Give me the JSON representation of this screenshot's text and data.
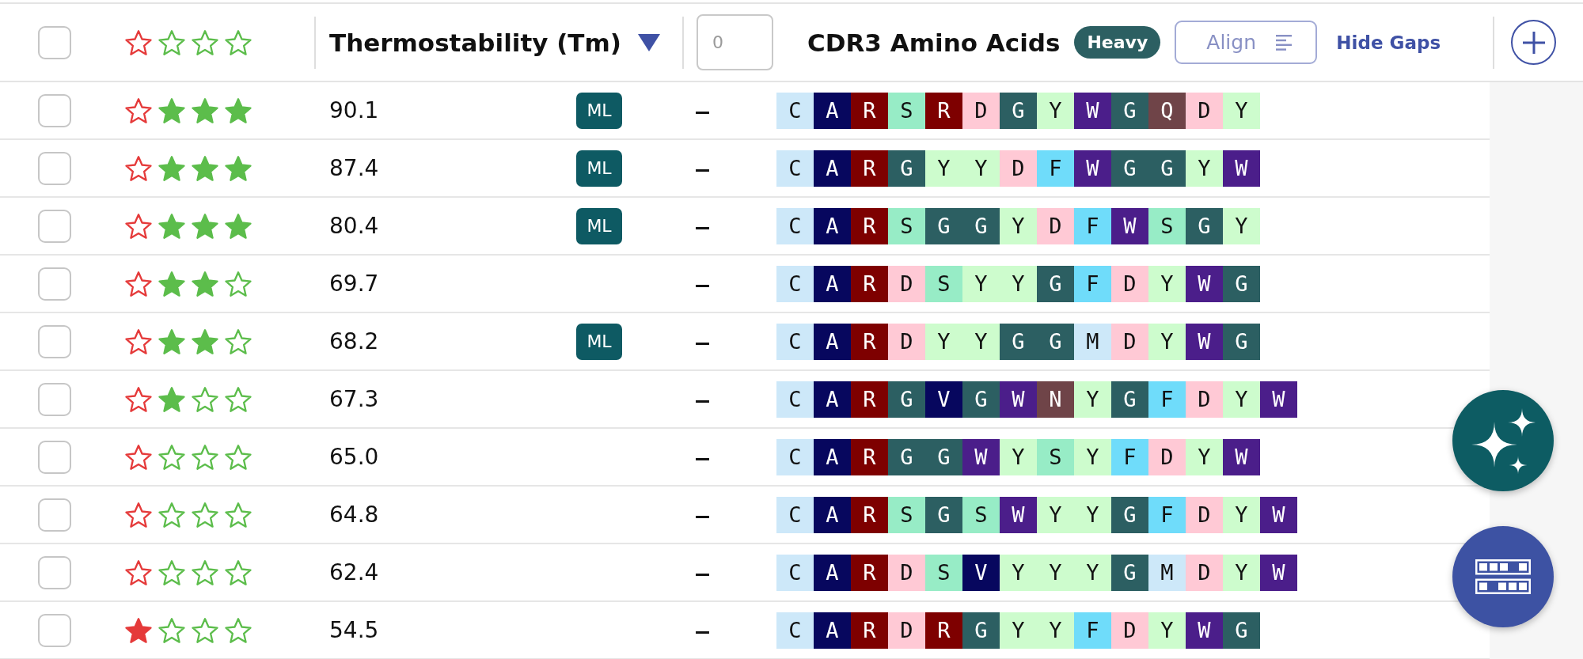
{
  "header": {
    "select_all": {
      "checked": false
    },
    "rating_filter": {
      "rejected": false,
      "stars": 0
    },
    "sort_column": {
      "label": "Thermostability (Tm)",
      "sort_descending": true
    },
    "filter_input": {
      "placeholder": "0"
    },
    "sequence_column": {
      "label": "CDR3 Amino Acids",
      "chain": "Heavy",
      "align_button": "Align",
      "gaps_link": "Hide Gaps"
    }
  },
  "rows": [
    {
      "checked": false,
      "rejected": false,
      "stars": 3,
      "tm": "90.1",
      "badge": "ML",
      "column_4": "–",
      "residues": [
        {
          "letter": "C",
          "color": "#cde8f9"
        },
        {
          "letter": "A",
          "color": "#07075e"
        },
        {
          "letter": "R",
          "color": "#7e0000"
        },
        {
          "letter": "S",
          "color": "#97ecc6"
        },
        {
          "letter": "R",
          "color": "#7e0000"
        },
        {
          "letter": "D",
          "color": "#ffc9d5"
        },
        {
          "letter": "G",
          "color": "#2c5f62"
        },
        {
          "letter": "Y",
          "color": "#cdfccd"
        },
        {
          "letter": "W",
          "color": "#4b1e8a"
        },
        {
          "letter": "G",
          "color": "#2c5f62"
        },
        {
          "letter": "Q",
          "color": "#6f4448"
        },
        {
          "letter": "D",
          "color": "#ffc9d5"
        },
        {
          "letter": "Y",
          "color": "#cdfccd"
        }
      ]
    },
    {
      "checked": false,
      "rejected": false,
      "stars": 3,
      "tm": "87.4",
      "badge": "ML",
      "column_4": "–",
      "residues": [
        {
          "letter": "C",
          "color": "#cde8f9"
        },
        {
          "letter": "A",
          "color": "#07075e"
        },
        {
          "letter": "R",
          "color": "#7e0000"
        },
        {
          "letter": "G",
          "color": "#2c5f62"
        },
        {
          "letter": "Y",
          "color": "#cdfccd"
        },
        {
          "letter": "Y",
          "color": "#cdfccd"
        },
        {
          "letter": "D",
          "color": "#ffc9d5"
        },
        {
          "letter": "F",
          "color": "#6fdcfa"
        },
        {
          "letter": "W",
          "color": "#4b1e8a"
        },
        {
          "letter": "G",
          "color": "#2c5f62"
        },
        {
          "letter": "G",
          "color": "#2c5f62"
        },
        {
          "letter": "Y",
          "color": "#cdfccd"
        },
        {
          "letter": "W",
          "color": "#4b1e8a"
        }
      ]
    },
    {
      "checked": false,
      "rejected": false,
      "stars": 3,
      "tm": "80.4",
      "badge": "ML",
      "column_4": "–",
      "residues": [
        {
          "letter": "C",
          "color": "#cde8f9"
        },
        {
          "letter": "A",
          "color": "#07075e"
        },
        {
          "letter": "R",
          "color": "#7e0000"
        },
        {
          "letter": "S",
          "color": "#97ecc6"
        },
        {
          "letter": "G",
          "color": "#2c5f62"
        },
        {
          "letter": "G",
          "color": "#2c5f62"
        },
        {
          "letter": "Y",
          "color": "#cdfccd"
        },
        {
          "letter": "D",
          "color": "#ffc9d5"
        },
        {
          "letter": "F",
          "color": "#6fdcfa"
        },
        {
          "letter": "W",
          "color": "#4b1e8a"
        },
        {
          "letter": "S",
          "color": "#97ecc6"
        },
        {
          "letter": "G",
          "color": "#2c5f62"
        },
        {
          "letter": "Y",
          "color": "#cdfccd"
        }
      ]
    },
    {
      "checked": false,
      "rejected": false,
      "stars": 2,
      "tm": "69.7",
      "column_4": "–",
      "residues": [
        {
          "letter": "C",
          "color": "#cde8f9"
        },
        {
          "letter": "A",
          "color": "#07075e"
        },
        {
          "letter": "R",
          "color": "#7e0000"
        },
        {
          "letter": "D",
          "color": "#ffc9d5"
        },
        {
          "letter": "S",
          "color": "#97ecc6"
        },
        {
          "letter": "Y",
          "color": "#cdfccd"
        },
        {
          "letter": "Y",
          "color": "#cdfccd"
        },
        {
          "letter": "G",
          "color": "#2c5f62"
        },
        {
          "letter": "F",
          "color": "#6fdcfa"
        },
        {
          "letter": "D",
          "color": "#ffc9d5"
        },
        {
          "letter": "Y",
          "color": "#cdfccd"
        },
        {
          "letter": "W",
          "color": "#4b1e8a"
        },
        {
          "letter": "G",
          "color": "#2c5f62"
        }
      ]
    },
    {
      "checked": false,
      "rejected": false,
      "stars": 2,
      "tm": "68.2",
      "badge": "ML",
      "column_4": "–",
      "residues": [
        {
          "letter": "C",
          "color": "#cde8f9"
        },
        {
          "letter": "A",
          "color": "#07075e"
        },
        {
          "letter": "R",
          "color": "#7e0000"
        },
        {
          "letter": "D",
          "color": "#ffc9d5"
        },
        {
          "letter": "Y",
          "color": "#cdfccd"
        },
        {
          "letter": "Y",
          "color": "#cdfccd"
        },
        {
          "letter": "G",
          "color": "#2c5f62"
        },
        {
          "letter": "G",
          "color": "#2c5f62"
        },
        {
          "letter": "M",
          "color": "#cde8f9"
        },
        {
          "letter": "D",
          "color": "#ffc9d5"
        },
        {
          "letter": "Y",
          "color": "#cdfccd"
        },
        {
          "letter": "W",
          "color": "#4b1e8a"
        },
        {
          "letter": "G",
          "color": "#2c5f62"
        }
      ]
    },
    {
      "checked": false,
      "rejected": false,
      "stars": 1,
      "tm": "67.3",
      "column_4": "–",
      "residues": [
        {
          "letter": "C",
          "color": "#cde8f9"
        },
        {
          "letter": "A",
          "color": "#07075e"
        },
        {
          "letter": "R",
          "color": "#7e0000"
        },
        {
          "letter": "G",
          "color": "#2c5f62"
        },
        {
          "letter": "V",
          "color": "#07075e"
        },
        {
          "letter": "G",
          "color": "#2c5f62"
        },
        {
          "letter": "W",
          "color": "#4b1e8a"
        },
        {
          "letter": "N",
          "color": "#6f4448"
        },
        {
          "letter": "Y",
          "color": "#cdfccd"
        },
        {
          "letter": "G",
          "color": "#2c5f62"
        },
        {
          "letter": "F",
          "color": "#6fdcfa"
        },
        {
          "letter": "D",
          "color": "#ffc9d5"
        },
        {
          "letter": "Y",
          "color": "#cdfccd"
        },
        {
          "letter": "W",
          "color": "#4b1e8a"
        }
      ]
    },
    {
      "checked": false,
      "rejected": false,
      "stars": 0,
      "tm": "65.0",
      "column_4": "–",
      "residues": [
        {
          "letter": "C",
          "color": "#cde8f9"
        },
        {
          "letter": "A",
          "color": "#07075e"
        },
        {
          "letter": "R",
          "color": "#7e0000"
        },
        {
          "letter": "G",
          "color": "#2c5f62"
        },
        {
          "letter": "G",
          "color": "#2c5f62"
        },
        {
          "letter": "W",
          "color": "#4b1e8a"
        },
        {
          "letter": "Y",
          "color": "#cdfccd"
        },
        {
          "letter": "S",
          "color": "#97ecc6"
        },
        {
          "letter": "Y",
          "color": "#cdfccd"
        },
        {
          "letter": "F",
          "color": "#6fdcfa"
        },
        {
          "letter": "D",
          "color": "#ffc9d5"
        },
        {
          "letter": "Y",
          "color": "#cdfccd"
        },
        {
          "letter": "W",
          "color": "#4b1e8a"
        }
      ]
    },
    {
      "checked": false,
      "rejected": false,
      "stars": 0,
      "tm": "64.8",
      "column_4": "–",
      "residues": [
        {
          "letter": "C",
          "color": "#cde8f9"
        },
        {
          "letter": "A",
          "color": "#07075e"
        },
        {
          "letter": "R",
          "color": "#7e0000"
        },
        {
          "letter": "S",
          "color": "#97ecc6"
        },
        {
          "letter": "G",
          "color": "#2c5f62"
        },
        {
          "letter": "S",
          "color": "#97ecc6"
        },
        {
          "letter": "W",
          "color": "#4b1e8a"
        },
        {
          "letter": "Y",
          "color": "#cdfccd"
        },
        {
          "letter": "Y",
          "color": "#cdfccd"
        },
        {
          "letter": "G",
          "color": "#2c5f62"
        },
        {
          "letter": "F",
          "color": "#6fdcfa"
        },
        {
          "letter": "D",
          "color": "#ffc9d5"
        },
        {
          "letter": "Y",
          "color": "#cdfccd"
        },
        {
          "letter": "W",
          "color": "#4b1e8a"
        }
      ]
    },
    {
      "checked": false,
      "rejected": false,
      "stars": 0,
      "tm": "62.4",
      "column_4": "–",
      "residues": [
        {
          "letter": "C",
          "color": "#cde8f9"
        },
        {
          "letter": "A",
          "color": "#07075e"
        },
        {
          "letter": "R",
          "color": "#7e0000"
        },
        {
          "letter": "D",
          "color": "#ffc9d5"
        },
        {
          "letter": "S",
          "color": "#97ecc6"
        },
        {
          "letter": "V",
          "color": "#07075e"
        },
        {
          "letter": "Y",
          "color": "#cdfccd"
        },
        {
          "letter": "Y",
          "color": "#cdfccd"
        },
        {
          "letter": "Y",
          "color": "#cdfccd"
        },
        {
          "letter": "G",
          "color": "#2c5f62"
        },
        {
          "letter": "M",
          "color": "#cde8f9"
        },
        {
          "letter": "D",
          "color": "#ffc9d5"
        },
        {
          "letter": "Y",
          "color": "#cdfccd"
        },
        {
          "letter": "W",
          "color": "#4b1e8a"
        }
      ]
    },
    {
      "checked": false,
      "rejected": true,
      "stars": 0,
      "tm": "54.5",
      "column_4": "–",
      "residues": [
        {
          "letter": "C",
          "color": "#cde8f9"
        },
        {
          "letter": "A",
          "color": "#07075e"
        },
        {
          "letter": "R",
          "color": "#7e0000"
        },
        {
          "letter": "D",
          "color": "#ffc9d5"
        },
        {
          "letter": "R",
          "color": "#7e0000"
        },
        {
          "letter": "G",
          "color": "#2c5f62"
        },
        {
          "letter": "Y",
          "color": "#cdfccd"
        },
        {
          "letter": "Y",
          "color": "#cdfccd"
        },
        {
          "letter": "F",
          "color": "#6fdcfa"
        },
        {
          "letter": "D",
          "color": "#ffc9d5"
        },
        {
          "letter": "Y",
          "color": "#cdfccd"
        },
        {
          "letter": "W",
          "color": "#4b1e8a"
        },
        {
          "letter": "G",
          "color": "#2c5f62"
        }
      ]
    }
  ]
}
